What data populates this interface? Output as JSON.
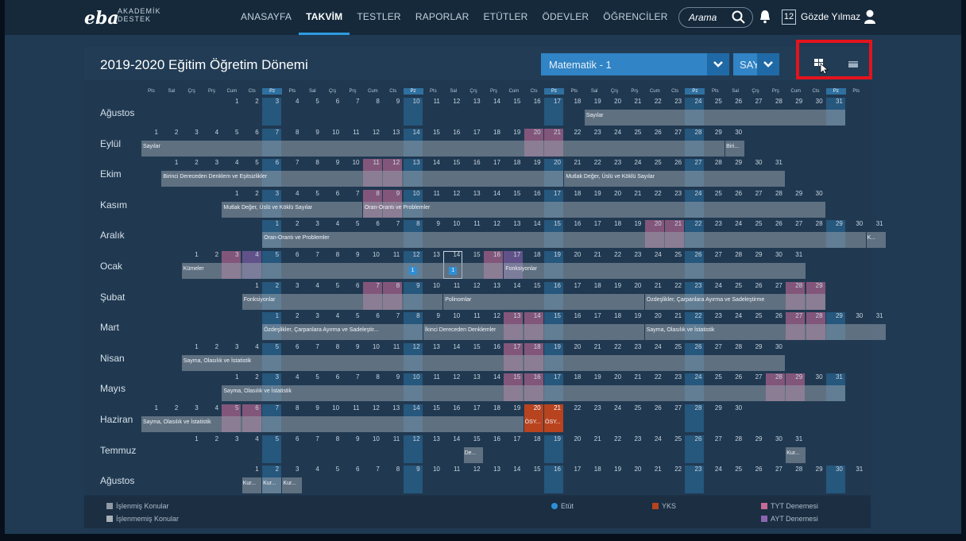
{
  "app": {
    "logo": "eba",
    "logo_sub": "AKADEMİK DESTEK"
  },
  "nav": [
    {
      "label": "ANASAYFA"
    },
    {
      "label": "TAKVİM"
    },
    {
      "label": "TESTLER"
    },
    {
      "label": "RAPORLAR"
    },
    {
      "label": "ETÜTLER"
    },
    {
      "label": "ÖDEVLER"
    },
    {
      "label": "ÖĞRENCİLER"
    }
  ],
  "nav_active_index": 1,
  "search": {
    "placeholder": "Arama"
  },
  "calendar_badge": "12",
  "user": {
    "name": "Gözde Yılmaz"
  },
  "panel": {
    "title": "2019-2020 Eğitim Öğretim Dönemi",
    "subject": "Matematik - 1",
    "track": "SAY"
  },
  "weekday_headers": [
    "Pts",
    "Sal",
    "Çrş",
    "Prş",
    "Cum",
    "Cts",
    "Pz"
  ],
  "months": [
    {
      "name": "Ağustos",
      "days": 31,
      "start": 4,
      "tyt": [],
      "ayt": [],
      "yks": [],
      "bars": [
        {
          "from": 19,
          "to": 31,
          "label": "Sayılar"
        }
      ]
    },
    {
      "name": "Eylül",
      "days": 30,
      "start": 0,
      "tyt": [
        20,
        21
      ],
      "ayt": [],
      "yks": [],
      "bars": [
        {
          "from": 1,
          "to": 29,
          "label": "Sayılar"
        },
        {
          "from": 30,
          "to": 30,
          "label": "Biri..."
        }
      ]
    },
    {
      "name": "Ekim",
      "days": 31,
      "start": 1,
      "tyt": [
        11,
        12
      ],
      "ayt": [],
      "yks": [],
      "bars": [
        {
          "from": 1,
          "to": 20,
          "label": "Birinci Dereceden Denklem ve Eşitsizlikler"
        },
        {
          "from": 21,
          "to": 31,
          "label": "Mutlak Değer, Üslü ve Köklü Sayılar"
        }
      ]
    },
    {
      "name": "Kasım",
      "days": 30,
      "start": 4,
      "tyt": [
        8,
        9
      ],
      "ayt": [],
      "yks": [],
      "bars": [
        {
          "from": 1,
          "to": 7,
          "label": "Mutlak Değer, Üslü ve Köklü Sayılar"
        },
        {
          "from": 8,
          "to": 30,
          "label": "Oran-Orantı ve Problemler"
        }
      ]
    },
    {
      "name": "Aralık",
      "days": 31,
      "start": 6,
      "tyt": [
        20,
        21
      ],
      "ayt": [],
      "yks": [],
      "bars": [
        {
          "from": 1,
          "to": 30,
          "label": "Oran-Orantı ve Problemler"
        },
        {
          "from": 31,
          "to": 31,
          "label": "K..."
        }
      ]
    },
    {
      "name": "Ocak",
      "days": 31,
      "start": 2,
      "tyt": [
        3,
        16
      ],
      "ayt": [
        4,
        17
      ],
      "yks": [],
      "today": 14,
      "etut": [
        {
          "day": 12,
          "label": "1"
        },
        {
          "day": 14,
          "label": "1"
        }
      ],
      "bars": [
        {
          "from": 1,
          "to": 16,
          "label": "Kümeler"
        },
        {
          "from": 17,
          "to": 31,
          "label": "Fonksiyonlar"
        }
      ]
    },
    {
      "name": "Şubat",
      "days": 29,
      "start": 5,
      "tyt": [
        7,
        8,
        28,
        29
      ],
      "ayt": [],
      "yks": [],
      "bars": [
        {
          "from": 1,
          "to": 10,
          "label": "Fonksiyonlar"
        },
        {
          "from": 11,
          "to": 20,
          "label": "Polinomlar"
        },
        {
          "from": 21,
          "to": 29,
          "label": "Özdeşlikler, Çarpanlara Ayırma ve Sadeleştirme"
        }
      ]
    },
    {
      "name": "Mart",
      "days": 31,
      "start": 6,
      "tyt": [
        13,
        14,
        27,
        28
      ],
      "ayt": [],
      "yks": [],
      "bars": [
        {
          "from": 1,
          "to": 8,
          "label": "Özdeşlikler, Çarpanlara Ayırma ve Sadeleştir..."
        },
        {
          "from": 9,
          "to": 19,
          "label": "İkinci Dereceden Denklemler"
        },
        {
          "from": 20,
          "to": 31,
          "label": "Sayma, Olasılık ve İstatistik"
        }
      ]
    },
    {
      "name": "Nisan",
      "days": 30,
      "start": 2,
      "tyt": [
        17,
        18
      ],
      "ayt": [],
      "yks": [],
      "bars": [
        {
          "from": 1,
          "to": 30,
          "label": "Sayma, Olasılık ve İstatistik"
        }
      ]
    },
    {
      "name": "Mayıs",
      "days": 31,
      "start": 4,
      "tyt": [
        15,
        16,
        28,
        29
      ],
      "ayt": [],
      "yks": [],
      "bars": [
        {
          "from": 1,
          "to": 31,
          "label": "Sayma, Olasılık ve İstatistik"
        }
      ]
    },
    {
      "name": "Haziran",
      "days": 30,
      "start": 0,
      "tyt": [
        5,
        6
      ],
      "ayt": [],
      "yks": [
        20,
        21
      ],
      "bars": [
        {
          "from": 1,
          "to": 19,
          "label": "Sayma, Olasılık ve İstatistik"
        },
        {
          "from": 20,
          "to": 20,
          "label": "ÖSY..."
        },
        {
          "from": 21,
          "to": 21,
          "label": "ÖSY..."
        }
      ]
    },
    {
      "name": "Temmuz",
      "days": 31,
      "start": 2,
      "tyt": [],
      "ayt": [],
      "yks": [],
      "bars": [
        {
          "from": 15,
          "to": 15,
          "label": "De..."
        },
        {
          "from": 31,
          "to": 31,
          "label": "Kur..."
        }
      ]
    },
    {
      "name": "Ağustos",
      "days": 31,
      "start": 5,
      "tyt": [],
      "ayt": [],
      "yks": [],
      "bars": [
        {
          "from": 1,
          "to": 1,
          "label": "Kur..."
        },
        {
          "from": 2,
          "to": 2,
          "label": "Kur..."
        },
        {
          "from": 3,
          "to": 3,
          "label": "Kur..."
        }
      ]
    }
  ],
  "legend": {
    "processed": "İşlenmiş Konular",
    "unprocessed": "İşlenmemiş Konular",
    "etut": "Etüt",
    "yks": "YKS",
    "tyt": "TYT Denemesi",
    "ayt": "AYT Denemesi"
  },
  "colors": {
    "accent": "#2e9be0",
    "highlight": "#e4131d",
    "tyt": "#c46b96",
    "ayt": "#8c64af",
    "yks": "#b8431f",
    "etut": "#2e8fd6"
  }
}
